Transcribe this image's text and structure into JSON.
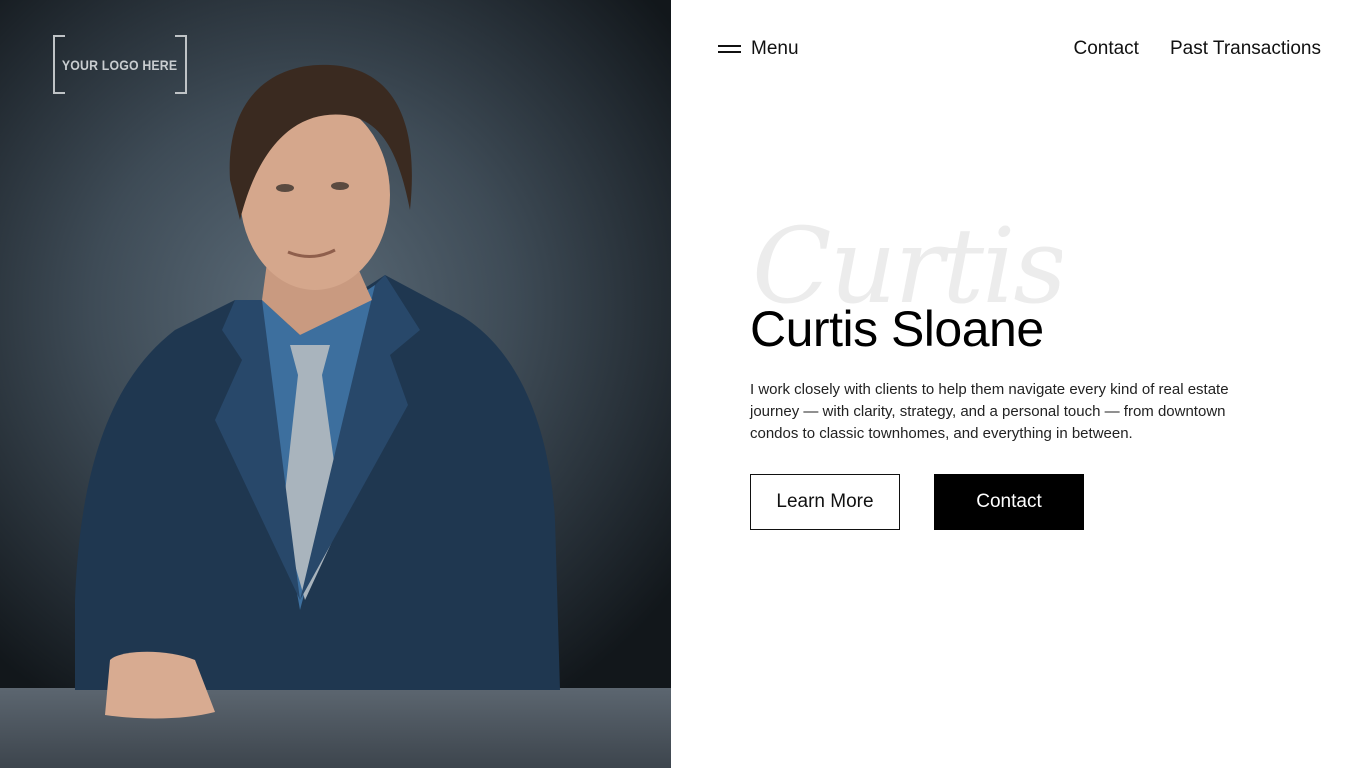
{
  "logo": {
    "text": "YOUR LOGO HERE"
  },
  "nav": {
    "menu_label": "Menu",
    "links": [
      "Contact",
      "Past Transactions"
    ]
  },
  "hero": {
    "script_text": "Curtis",
    "name": "Curtis Sloane",
    "bio": "I work closely with clients to help them navigate every kind of real estate journey — with clarity, strategy, and a personal touch — from downtown condos to classic townhomes, and everything in between.",
    "buttons": {
      "learn_more": "Learn More",
      "contact": "Contact"
    }
  },
  "icons": [
    "hamburger-menu-icon"
  ],
  "colors": {
    "text": "#111111",
    "button_solid_bg": "#000000",
    "button_solid_text": "#ffffff",
    "script_watermark": "#ececec"
  }
}
